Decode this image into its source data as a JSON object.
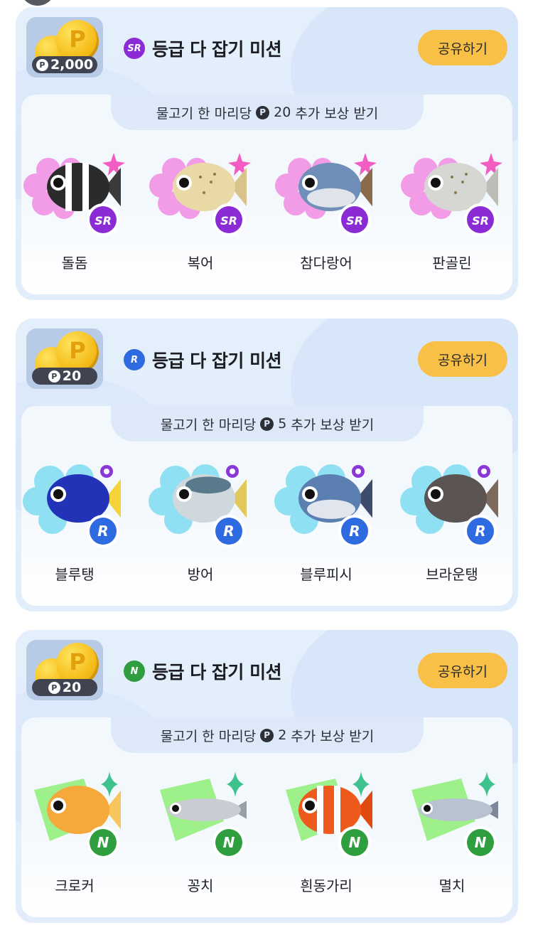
{
  "missions": [
    {
      "reward_value": "2,000",
      "grade": "SR",
      "grade_color": "#8b2bd6",
      "title": "등급 다 잡기 미션",
      "share_label": "공유하기",
      "subtitle_before": "물고기 한 마리당",
      "subtitle_amount": "20",
      "subtitle_after": "추가 보상 받기",
      "fish": [
        {
          "name": "돌돔",
          "icon": "striped-fish-icon"
        },
        {
          "name": "복어",
          "icon": "pufferfish-icon"
        },
        {
          "name": "참다랑어",
          "icon": "tuna-icon"
        },
        {
          "name": "판골린",
          "icon": "pangolin-fish-icon"
        }
      ]
    },
    {
      "reward_value": "20",
      "grade": "R",
      "grade_color": "#2f6be0",
      "title": "등급 다 잡기 미션",
      "share_label": "공유하기",
      "subtitle_before": "물고기 한 마리당",
      "subtitle_amount": "5",
      "subtitle_after": "추가 보상 받기",
      "fish": [
        {
          "name": "블루탱",
          "icon": "blue-tang-icon"
        },
        {
          "name": "방어",
          "icon": "yellowtail-icon"
        },
        {
          "name": "블루피시",
          "icon": "bluefish-icon"
        },
        {
          "name": "브라운탱",
          "icon": "brown-tang-icon"
        }
      ]
    },
    {
      "reward_value": "20",
      "grade": "N",
      "grade_color": "#2e9e3e",
      "title": "등급 다 잡기 미션",
      "share_label": "공유하기",
      "subtitle_before": "물고기 한 마리당",
      "subtitle_amount": "2",
      "subtitle_after": "추가 보상 받기",
      "fish": [
        {
          "name": "크로커",
          "icon": "croaker-icon"
        },
        {
          "name": "꽁치",
          "icon": "saury-icon"
        },
        {
          "name": "흰동가리",
          "icon": "clownfish-icon"
        },
        {
          "name": "멸치",
          "icon": "anchovy-icon"
        }
      ]
    }
  ],
  "colors": {
    "share_button": "#f8c046",
    "coin": "#f5bc19",
    "sr_flower": "#f29ce8",
    "r_blob": "#8fe0f2",
    "n_square": "#9ef08a"
  }
}
